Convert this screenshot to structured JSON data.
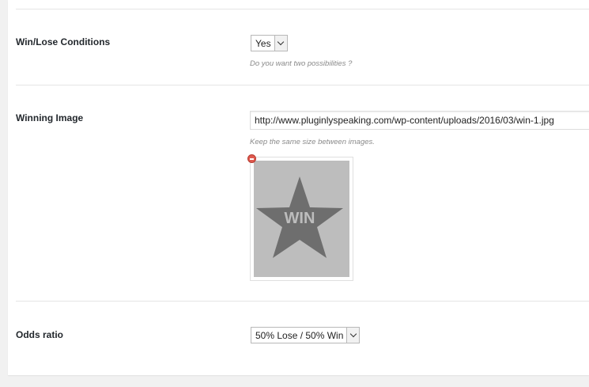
{
  "settings": {
    "win_lose": {
      "label": "Win/Lose Conditions",
      "value": "Yes",
      "hint": "Do you want two possibilities ?"
    },
    "winning_image": {
      "label": "Winning Image",
      "url": "http://www.pluginlyspeaking.com/wp-content/uploads/2016/03/win-1.jpg",
      "hint": "Keep the same size between images.",
      "preview_text": "WIN",
      "remove_icon": "remove-circle-icon",
      "preview_bg_color": "#bdbdbd",
      "star_color": "#6e6e6e"
    },
    "odds_ratio": {
      "label": "Odds ratio",
      "value": "50% Lose / 50% Win"
    }
  }
}
